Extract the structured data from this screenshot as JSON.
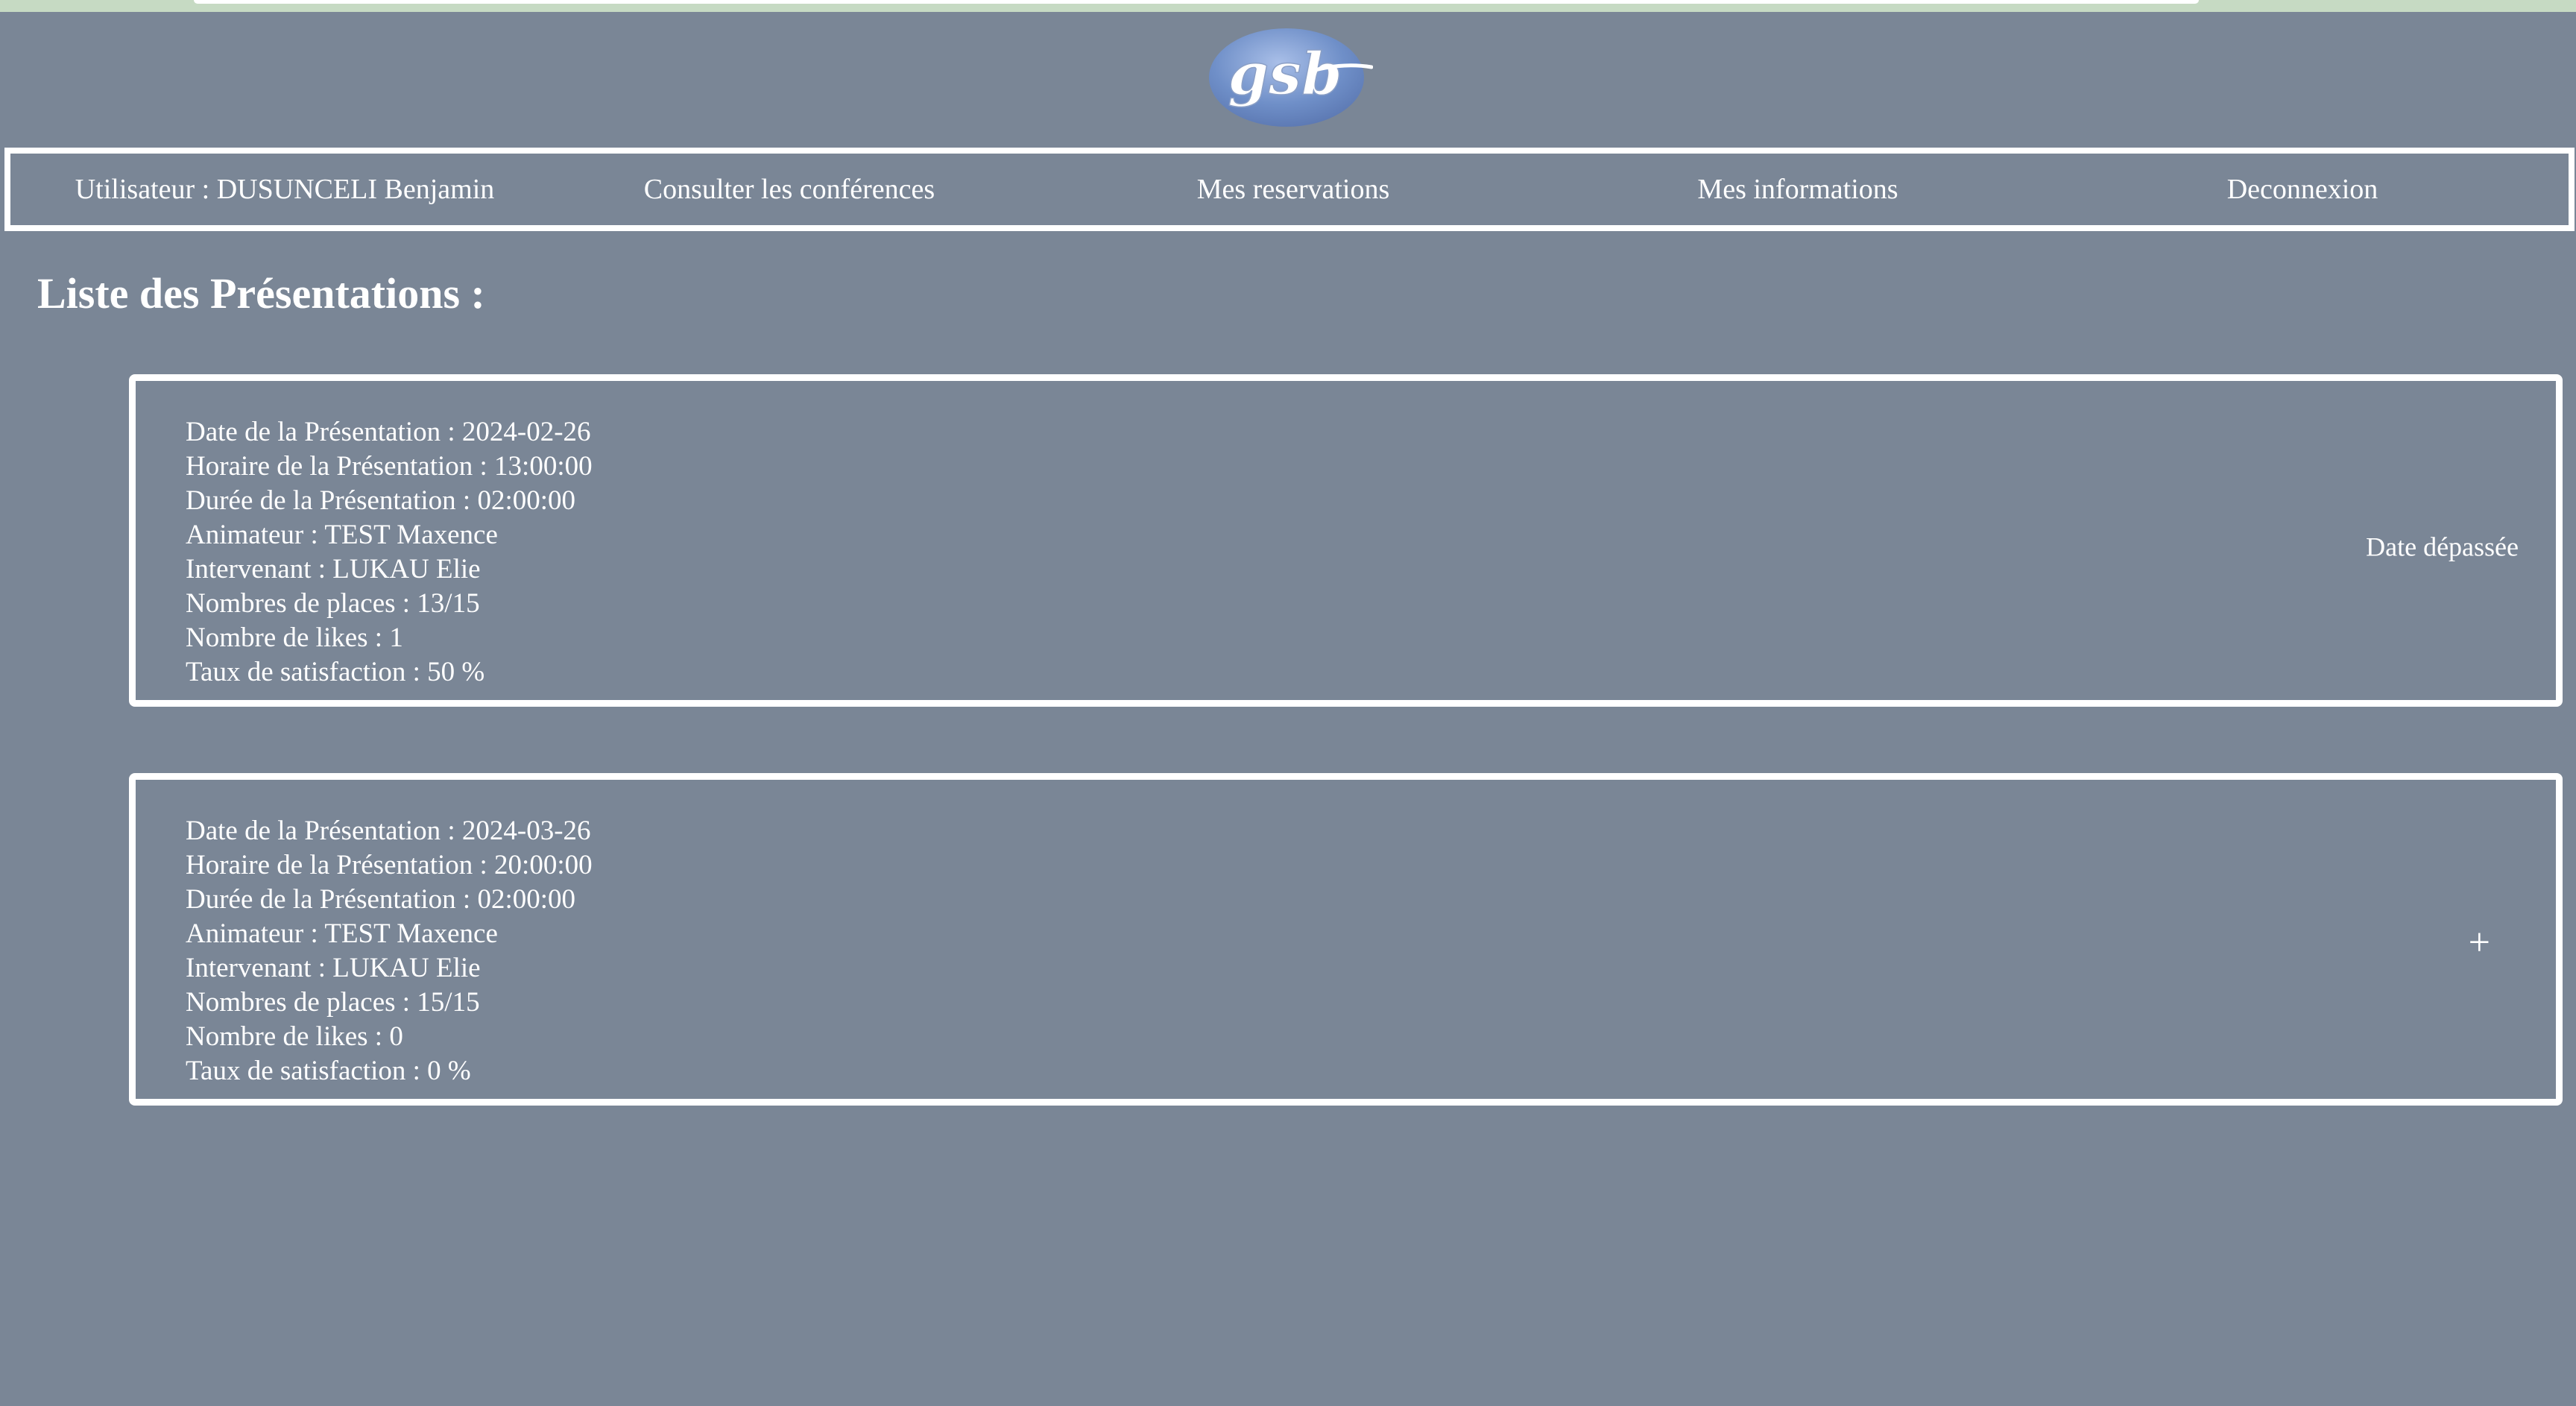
{
  "colors": {
    "background": "#7a8696",
    "top_strip": "#c6dac3",
    "text": "#ffffff",
    "logo_oval": "#6f8fc8"
  },
  "logo": {
    "text": "gsb"
  },
  "nav": {
    "user_label": "Utilisateur : DUSUNCELI Benjamin",
    "conferences_label": "Consulter les conférences",
    "reservations_label": "Mes reservations",
    "info_label": "Mes informations",
    "logout_label": "Deconnexion"
  },
  "page": {
    "title": "Liste des Présentations :"
  },
  "presentations": [
    {
      "date": "Date de la Présentation : 2024-02-26",
      "time": "Horaire de la Présentation : 13:00:00",
      "duration": "Durée de la Présentation : 02:00:00",
      "host": "Animateur : TEST Maxence",
      "speaker": "Intervenant : LUKAU Elie",
      "seats": "Nombres de places : 13/15",
      "likes": "Nombre de likes : 1",
      "satisfaction": "Taux de satisfaction : 50 %",
      "status": "Date dépassée"
    },
    {
      "date": "Date de la Présentation : 2024-03-26",
      "time": "Horaire de la Présentation : 20:00:00",
      "duration": "Durée de la Présentation : 02:00:00",
      "host": "Animateur : TEST Maxence",
      "speaker": "Intervenant : LUKAU Elie",
      "seats": "Nombres de places : 15/15",
      "likes": "Nombre de likes : 0",
      "satisfaction": "Taux de satisfaction : 0 %",
      "action_symbol": "+"
    }
  ]
}
